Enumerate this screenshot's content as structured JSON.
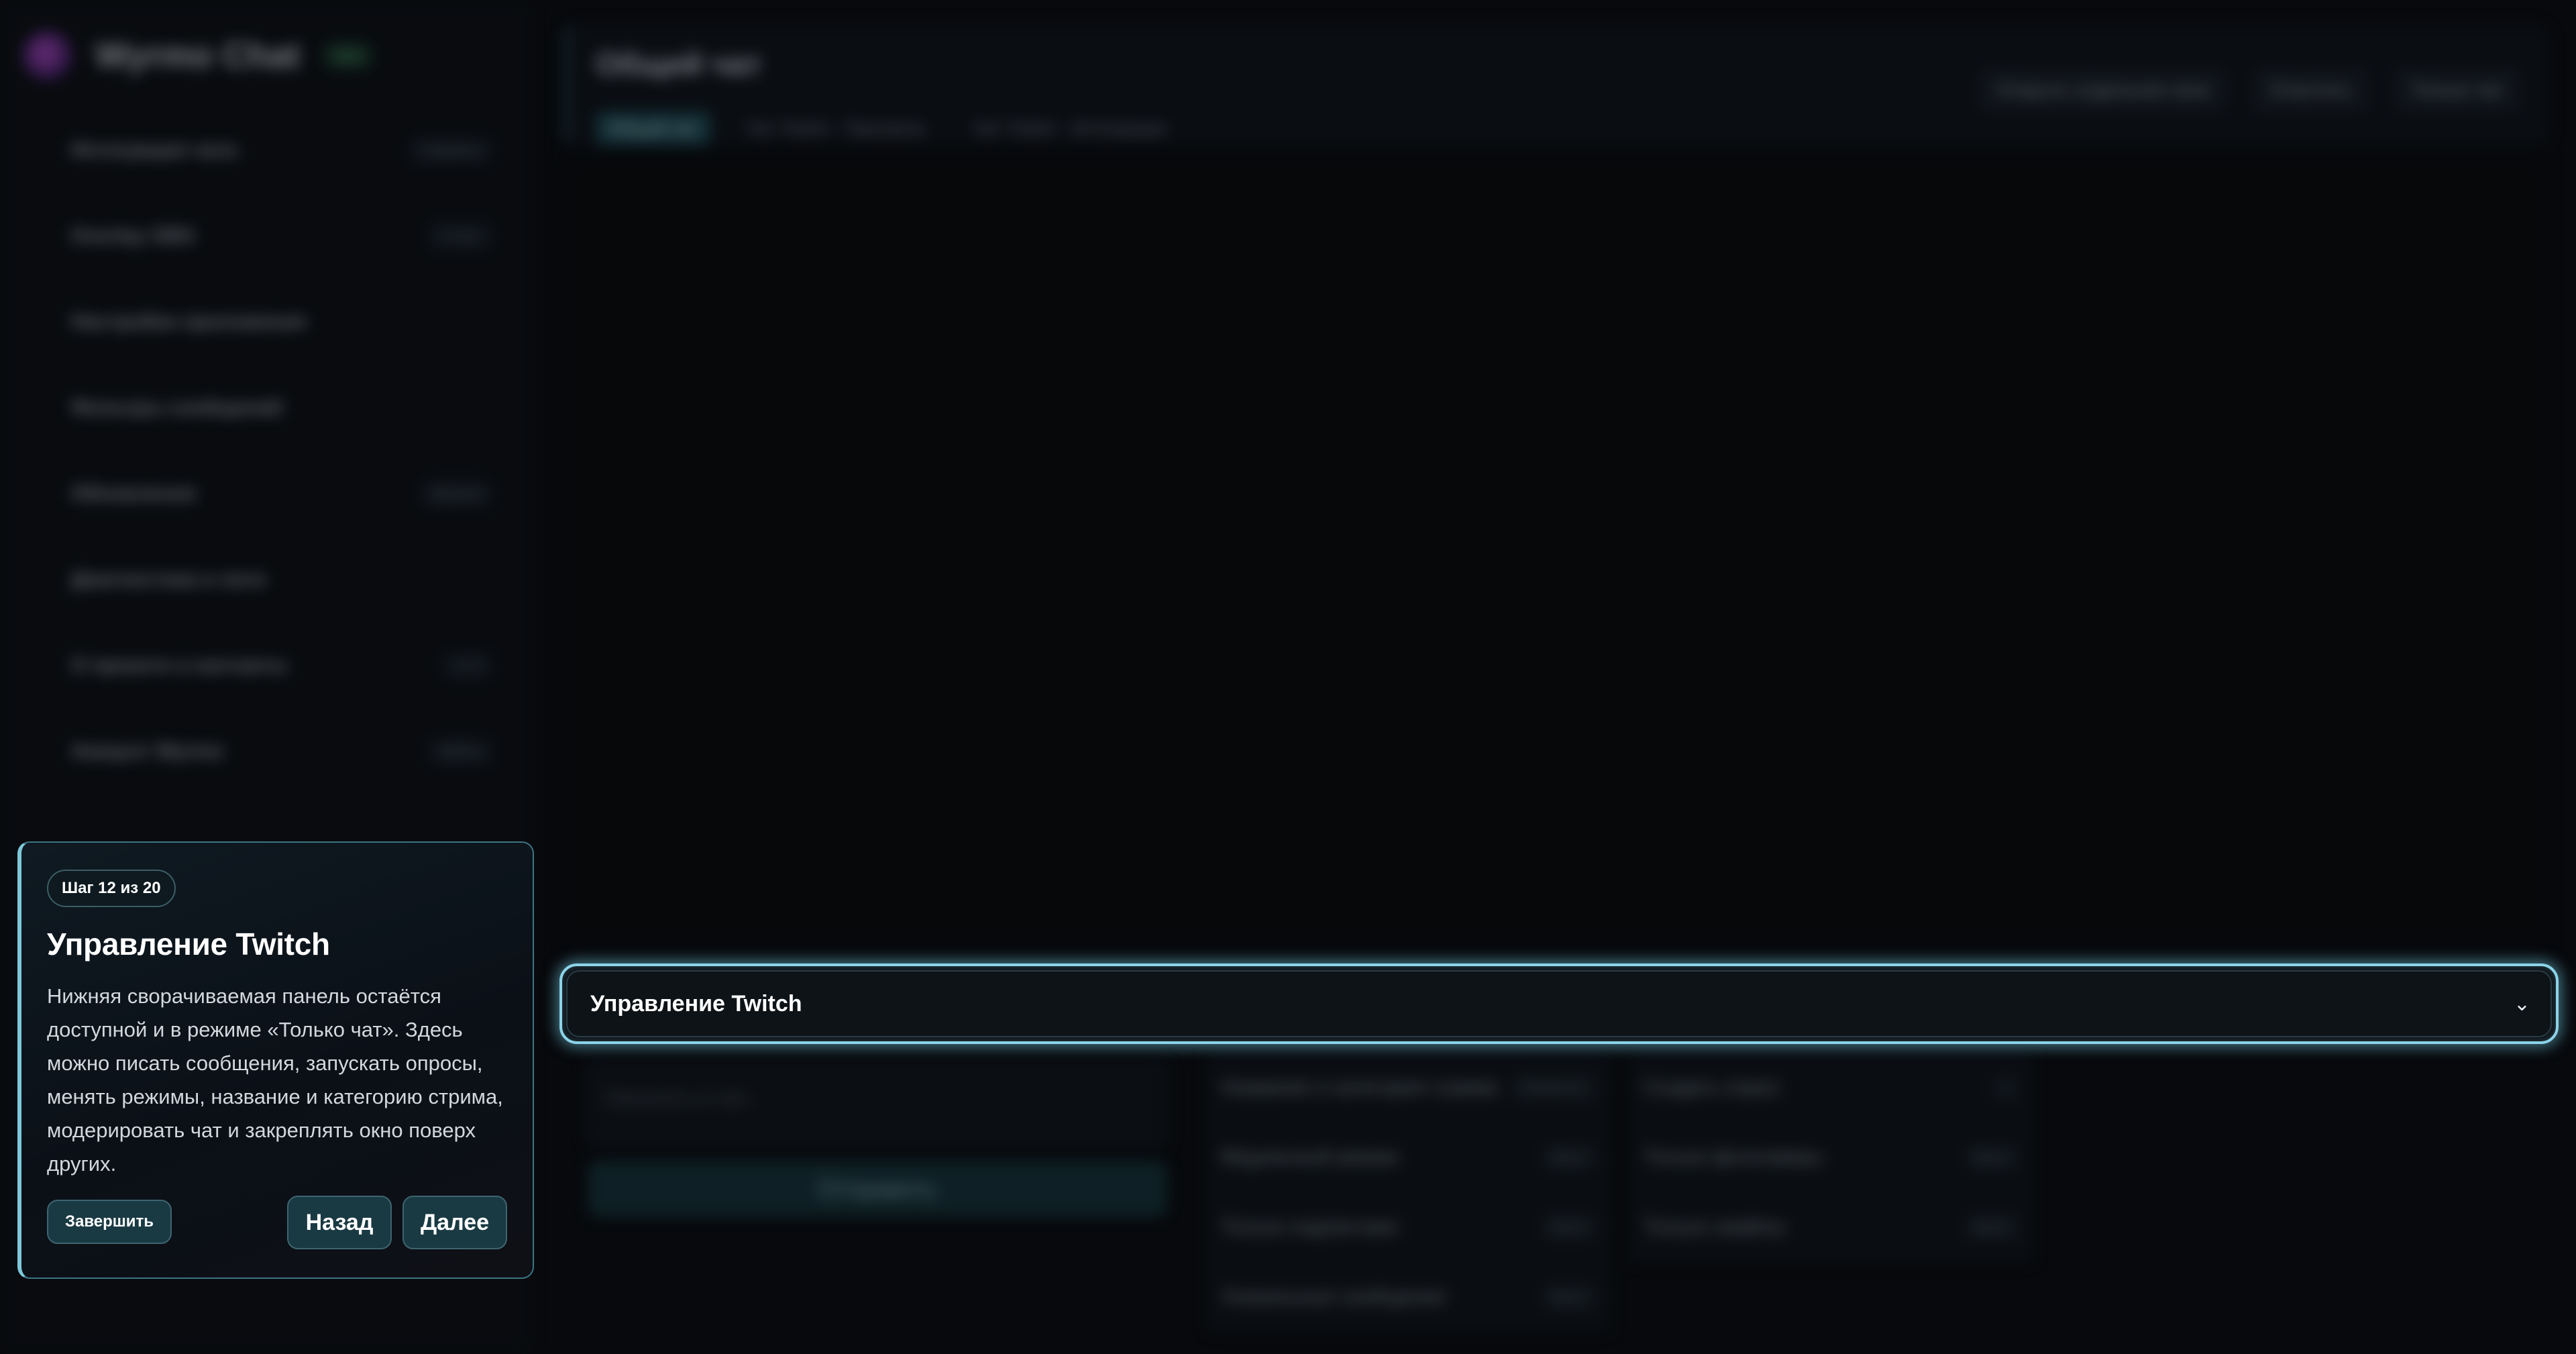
{
  "app": {
    "brand_name": "Wyrmo Chat",
    "brand_badge": "beta"
  },
  "sidebar": {
    "items": [
      {
        "label": "Интеграция чата",
        "tag": "Сервисы"
      },
      {
        "label": "Overlay OBS",
        "tag": "Стиль"
      },
      {
        "label": "Настройки приложения",
        "tag": ""
      },
      {
        "label": "Фильтры сообщений",
        "tag": ""
      },
      {
        "label": "Обновления",
        "tag": "Версия"
      },
      {
        "label": "Диагностика и логи",
        "tag": ""
      },
      {
        "label": "О проекте и контакты",
        "tag": "v1.0"
      },
      {
        "label": "Аккаунт Wyrmo",
        "tag": "Войти"
      }
    ]
  },
  "header": {
    "title": "Общий чат",
    "tabs": [
      {
        "label": "Общий чат"
      },
      {
        "label": "Чат Twitch · Просмотр"
      },
      {
        "label": "Чат Twitch · Интеграции"
      }
    ],
    "actions": [
      {
        "label": "Открыть отдельное окно"
      },
      {
        "label": "Очистить"
      },
      {
        "label": "Только чат"
      }
    ]
  },
  "compose": {
    "placeholder": "Написать в чат...",
    "send_label": "Отправить"
  },
  "controls": {
    "col1": [
      {
        "label": "Название и категория стрима",
        "tag": "Изменить"
      },
      {
        "label": "Медленный режим",
        "tag": "Выкл"
      },
      {
        "label": "Только подписчики",
        "tag": "Выкл"
      },
      {
        "label": "Уникальные сообщения",
        "tag": "Выкл"
      }
    ],
    "col2": [
      {
        "label": "Создать опрос",
        "tag": "+"
      },
      {
        "label": "Только фолловеры",
        "tag": "Выкл"
      },
      {
        "label": "Только смайлы",
        "tag": "Выкл"
      }
    ]
  },
  "highlight": {
    "title": "Управление Twitch",
    "chevron_icon": "chevron-down-icon"
  },
  "tour": {
    "step": "Шаг 12 из 20",
    "title": "Управление Twitch",
    "text": "Нижняя сворачиваемая панель остаётся доступной и в режиме «Только чат». Здесь можно писать сообщения, запускать опросы, менять режимы, название и категорию стрима, модерировать чат и закреплять окно поверх других.",
    "finish_label": "Завершить",
    "back_label": "Назад",
    "next_label": "Далее"
  },
  "colors": {
    "accent": "#7ec8db",
    "background": "#07090c",
    "card": "#0f1a22"
  }
}
